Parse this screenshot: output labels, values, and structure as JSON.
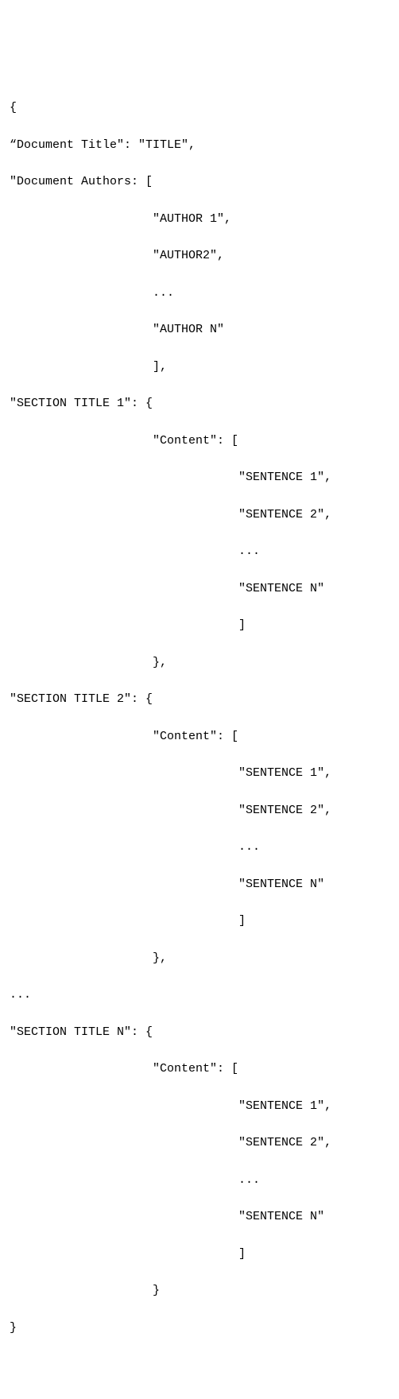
{
  "lines": [
    "{",
    "“Document Title\": \"TITLE\",",
    "\"Document Authors: [",
    "                    \"AUTHOR 1\",",
    "                    \"AUTHOR2\",",
    "                    ...",
    "                    \"AUTHOR N\"",
    "                    ],",
    "\"SECTION TITLE 1\": {",
    "                    \"Content\": [",
    "                                \"SENTENCE 1\",",
    "                                \"SENTENCE 2\",",
    "                                ...",
    "                                \"SENTENCE N\"",
    "                                ]",
    "                    },",
    "\"SECTION TITLE 2\": {",
    "                    \"Content\": [",
    "                                \"SENTENCE 1\",",
    "                                \"SENTENCE 2\",",
    "                                ...",
    "                                \"SENTENCE N\"",
    "                                ]",
    "                    },",
    "...",
    "\"SECTION TITLE N\": {",
    "                    \"Content\": [",
    "                                \"SENTENCE 1\",",
    "                                \"SENTENCE 2\",",
    "                                ...",
    "                                \"SENTENCE N\"",
    "                                ]",
    "                    }",
    "}"
  ]
}
